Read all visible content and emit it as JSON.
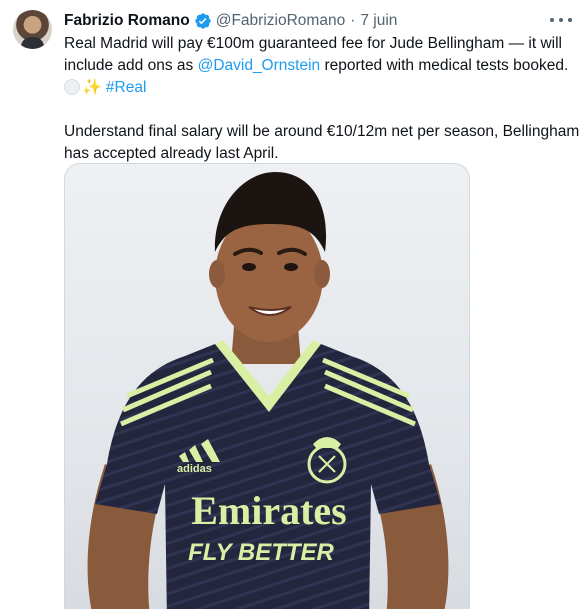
{
  "tweet": {
    "author_name": "Fabrizio Romano",
    "handle": "@FabrizioRomano",
    "separator": "·",
    "date": "7 juin",
    "verified_icon": "verified-badge-icon",
    "more_icon": "more-options-icon",
    "text": {
      "line1": "Real Madrid will pay €100m guaranteed fee for Jude Bellingham — it will",
      "line2_before": "include add ons as ",
      "line2_mention": "@David_Ornstein",
      "line2_after": " reported with medical tests booked.",
      "line3_hashtag": "#Real",
      "line4": "Understand final salary will be around €10/12m net per season, Bellingham",
      "line5": "has accepted already last April."
    },
    "media": {
      "kit_sponsor": "Emirates",
      "kit_slogan": "FLY BETTER",
      "kit_brand": "adidas"
    },
    "colors": {
      "link": "#1d9bf0",
      "secondary_text": "#536471",
      "jersey": "#23263d",
      "jersey_accent": "#d9efa4"
    }
  }
}
